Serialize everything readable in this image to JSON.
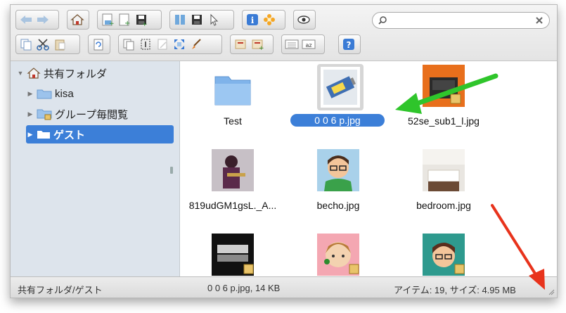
{
  "search": {
    "placeholder": "",
    "value": ""
  },
  "toolbar": {
    "row1": [
      "back-icon",
      "forward-icon",
      "home-icon",
      "new-folder-icon",
      "new-file-icon",
      "save-icon",
      "view-icon",
      "save-as-icon",
      "select-icon",
      "info-icon",
      "flower-icon",
      "eye-icon"
    ],
    "row2": [
      "copy-icon",
      "cut-icon",
      "paste-icon",
      "refresh-icon",
      "duplicate-icon",
      "rename-icon",
      "edit-icon",
      "resize-icon",
      "paint-icon",
      "extract-icon",
      "archive-icon",
      "list-view-icon",
      "sort-icon",
      "help-icon"
    ]
  },
  "sidebar": {
    "items": [
      {
        "label": "共有フォルダ"
      },
      {
        "label": "kisa"
      },
      {
        "label": "グループ毎閲覧"
      },
      {
        "label": "ゲスト"
      }
    ]
  },
  "files": [
    {
      "name": "Test",
      "kind": "folder"
    },
    {
      "name": "0 0 6 p.jpg",
      "kind": "image",
      "selected": true
    },
    {
      "name": "52se_sub1_l.jpg",
      "kind": "image"
    },
    {
      "name": "819udGM1gsL._A...",
      "kind": "image"
    },
    {
      "name": "becho.jpg",
      "kind": "image"
    },
    {
      "name": "bedroom.jpg",
      "kind": "image"
    },
    {
      "name": "",
      "kind": "image"
    },
    {
      "name": "",
      "kind": "image"
    },
    {
      "name": "",
      "kind": "image"
    }
  ],
  "status": {
    "path": "共有フォルダ/ゲスト",
    "selection": "0 0 6 p.jpg, 14 KB",
    "summary": "アイテム: 19, サイズ: 4.95 MB"
  },
  "colors": {
    "selection": "#3c7fd8",
    "sidebar": "#dde4ec",
    "arrow_green": "#2fc52b",
    "arrow_red": "#e8331c"
  }
}
